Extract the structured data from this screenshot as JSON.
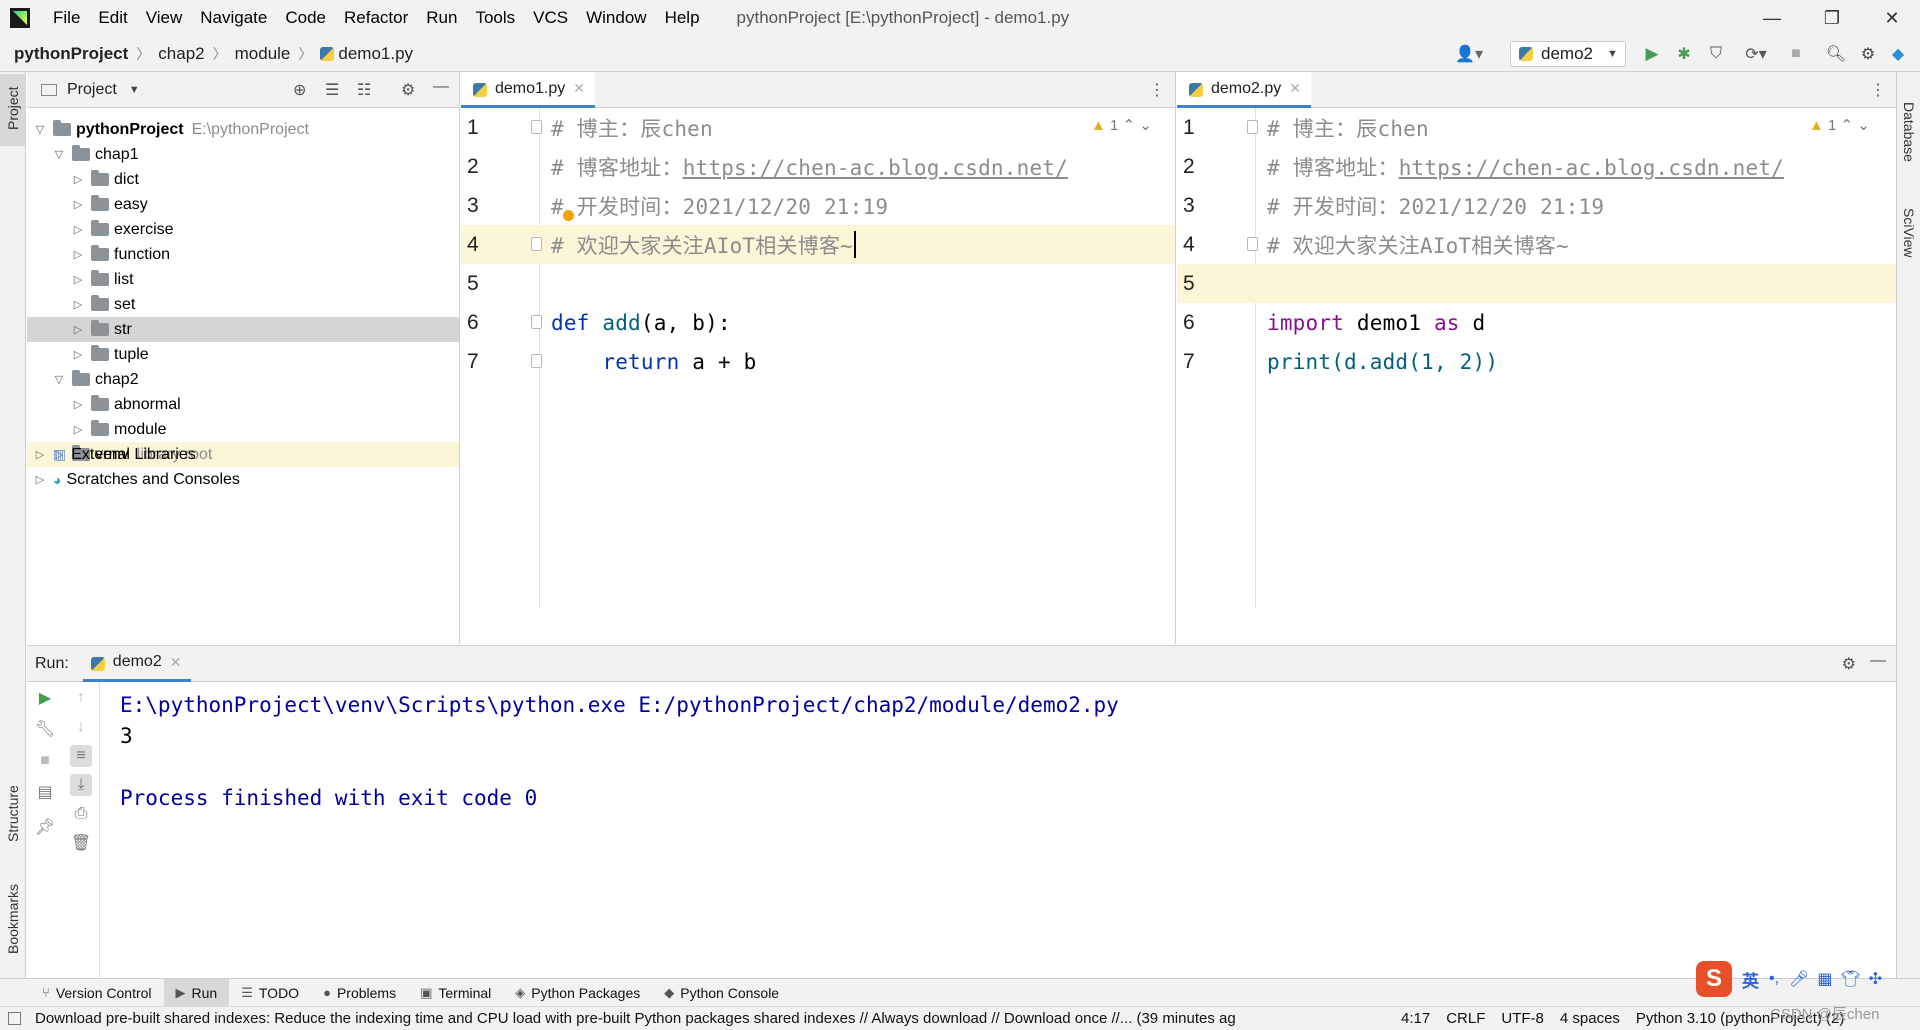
{
  "window": {
    "title": "pythonProject [E:\\pythonProject] - demo1.py",
    "menu": [
      "File",
      "Edit",
      "View",
      "Navigate",
      "Code",
      "Refactor",
      "Run",
      "Tools",
      "VCS",
      "Window",
      "Help"
    ],
    "controls": {
      "minimize": "—",
      "restore": "❐",
      "close": "✕"
    }
  },
  "navbar": {
    "breadcrumbs": [
      "pythonProject",
      "chap2",
      "module",
      "demo1.py"
    ],
    "run_config": "demo2"
  },
  "side_tabs": {
    "left": [
      "Project",
      "Structure",
      "Bookmarks"
    ],
    "right": [
      "Database",
      "SciView"
    ]
  },
  "project_panel": {
    "title": "Project",
    "root_name": "pythonProject",
    "root_path": "E:\\pythonProject",
    "tree": [
      {
        "label": "chap1",
        "indent": 1,
        "expanded": true
      },
      {
        "label": "dict",
        "indent": 2,
        "expanded": false
      },
      {
        "label": "easy",
        "indent": 2,
        "expanded": false
      },
      {
        "label": "exercise",
        "indent": 2,
        "expanded": false
      },
      {
        "label": "function",
        "indent": 2,
        "expanded": false
      },
      {
        "label": "list",
        "indent": 2,
        "expanded": false
      },
      {
        "label": "set",
        "indent": 2,
        "expanded": false
      },
      {
        "label": "str",
        "indent": 2,
        "expanded": false,
        "selected": true
      },
      {
        "label": "tuple",
        "indent": 2,
        "expanded": false
      },
      {
        "label": "chap2",
        "indent": 1,
        "expanded": true
      },
      {
        "label": "abnormal",
        "indent": 2,
        "expanded": false
      },
      {
        "label": "module",
        "indent": 2,
        "expanded": false
      },
      {
        "label": "venv",
        "indent": 1,
        "expanded": false,
        "suffix": "library root"
      }
    ],
    "external_libraries": "External Libraries",
    "scratches": "Scratches and Consoles"
  },
  "editor_left": {
    "tab": "demo1.py",
    "inspection_count": "1",
    "line_numbers": [
      "1",
      "2",
      "3",
      "4",
      "5",
      "6",
      "7"
    ],
    "line1": "# 博主：辰chen",
    "line2_prefix": "# 博客地址：",
    "line2_link": "https://chen-ac.blog.csdn.net/",
    "line3": "# 开发时间：2021/12/20 21:19",
    "line4": "# 欢迎大家关注AIoT相关博客~",
    "line6_kw": "def",
    "line6_fn": "add",
    "line6_rest": "(a, b):",
    "line7_kw": "return",
    "line7_rest": "a + b"
  },
  "editor_right": {
    "tab": "demo2.py",
    "inspection_count": "1",
    "line_numbers": [
      "1",
      "2",
      "3",
      "4",
      "5",
      "6",
      "7"
    ],
    "line1": "# 博主：辰chen",
    "line2_prefix": "# 博客地址：",
    "line2_link": "https://chen-ac.blog.csdn.net/",
    "line3": "# 开发时间：2021/12/20 21:19",
    "line4": "# 欢迎大家关注AIoT相关博客~",
    "line6_kw1": "import",
    "line6_mod": "demo1",
    "line6_kw2": "as",
    "line6_alias": "d",
    "line7_fn": "print",
    "line7_rest": "(d.add(1, 2))"
  },
  "run_panel": {
    "label": "Run:",
    "tab": "demo2",
    "output": [
      "E:\\pythonProject\\venv\\Scripts\\python.exe E:/pythonProject/chap2/module/demo2.py",
      "3",
      "",
      "Process finished with exit code 0"
    ]
  },
  "tool_tabs": [
    "Version Control",
    "Run",
    "TODO",
    "Problems",
    "Terminal",
    "Python Packages",
    "Python Console"
  ],
  "status_bar": {
    "message": "Download pre-built shared indexes: Reduce the indexing time and CPU load with pre-built Python packages shared indexes // Always download // Download once //... (39 minutes ag",
    "position": "4:17",
    "line_sep": "CRLF",
    "encoding": "UTF-8",
    "indent": "4 spaces",
    "interpreter": "Python 3.10 (pythonProject) (2)"
  },
  "ime": {
    "lang": "英",
    "watermark": "CSDN @辰chen"
  },
  "colors": {
    "accent": "#4083c9",
    "run_green": "#499c54",
    "current_line": "#fcf5d7",
    "keyword": "#0033b3",
    "function": "#00627a",
    "console_blue": "#0000a0"
  }
}
